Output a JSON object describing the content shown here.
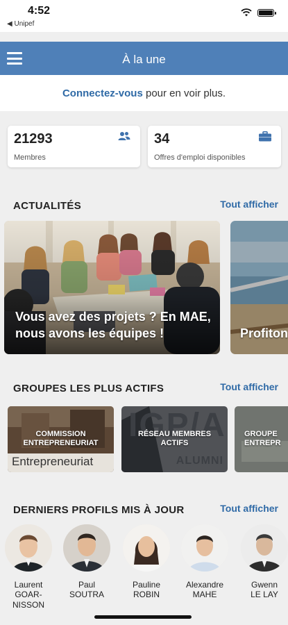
{
  "status": {
    "time": "4:52",
    "back_label": "◀ Unipef"
  },
  "nav": {
    "title": "À la une"
  },
  "login": {
    "link": "Connectez-vous",
    "rest": " pour en voir plus."
  },
  "stats": [
    {
      "value": "21293",
      "label": "Membres",
      "icon": "users-icon"
    },
    {
      "value": "34",
      "label": "Offres d'emploi disponibles",
      "icon": "briefcase-icon"
    }
  ],
  "news": {
    "title": "ACTUALITÉS",
    "link": "Tout afficher",
    "items": [
      {
        "title": "Vous avez des projets ? En MAE, nous avons les équipes !"
      },
      {
        "title": "Profiton"
      }
    ]
  },
  "groups": {
    "title": "GROUPES LES PLUS ACTIFS",
    "link": "Tout afficher",
    "items": [
      {
        "title": "Commission Entrepreneuriat",
        "banner": "Entrepreneuriat"
      },
      {
        "title": "Réseau membres actifs",
        "banner": "ALUMNI",
        "logo": "IGP/AE"
      },
      {
        "title": "Groupe Entrepr"
      }
    ]
  },
  "profiles": {
    "title": "DERNIERS PROFILS MIS À JOUR",
    "link": "Tout afficher",
    "items": [
      {
        "first": "Laurent",
        "last": "GOAR-NISSON"
      },
      {
        "first": "Paul",
        "last": "SOUTRA"
      },
      {
        "first": "Pauline",
        "last": "ROBIN"
      },
      {
        "first": "Alexandre",
        "last": "MAHE"
      },
      {
        "first": "Gwenn",
        "last": "LE LAY"
      }
    ]
  },
  "colors": {
    "accent": "#4f80b8",
    "link": "#2f6aa6",
    "background": "#efefef"
  }
}
